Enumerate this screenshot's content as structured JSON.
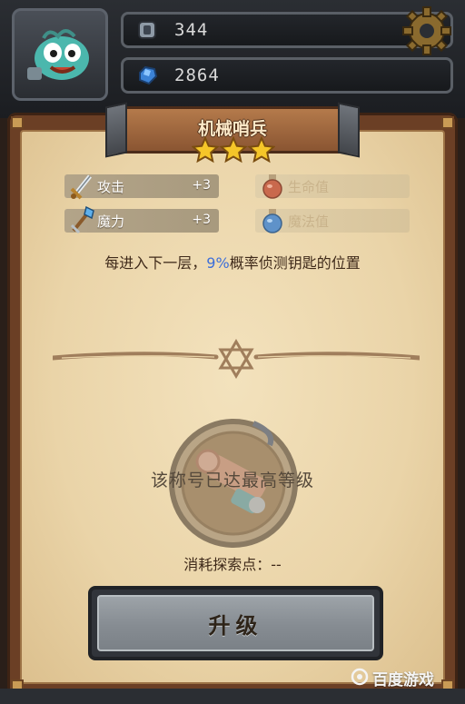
{
  "hud": {
    "resource1_value": "344",
    "resource2_value": "2864",
    "resource1_icon": "scroll-token-icon",
    "resource2_icon": "blue-gem-icon",
    "settings_icon": "gear-icon"
  },
  "panel": {
    "title": "机械哨兵",
    "stars": 3,
    "stats": [
      {
        "label": "攻击",
        "bonus": "+3",
        "icon": "sword-icon",
        "active": true
      },
      {
        "label": "魔力",
        "bonus": "+3",
        "icon": "staff-icon",
        "active": true
      },
      {
        "label": "生命值",
        "bonus": "",
        "icon": "red-potion-icon",
        "active": false
      },
      {
        "label": "魔法值",
        "bonus": "",
        "icon": "blue-potion-icon",
        "active": false
      }
    ],
    "description_prefix": "每进入下一层，",
    "description_pct": "9%",
    "description_suffix": "概率侦测钥匙的位置",
    "max_level_text": "该称号已达最高等级",
    "cost_text": "消耗探索点：--",
    "upgrade_label": "升级"
  },
  "watermark": "百度游戏",
  "colors": {
    "parchment": "#ead4a8",
    "highlight_blue": "#3d6fd9",
    "frame_brown": "#6b3f25"
  }
}
